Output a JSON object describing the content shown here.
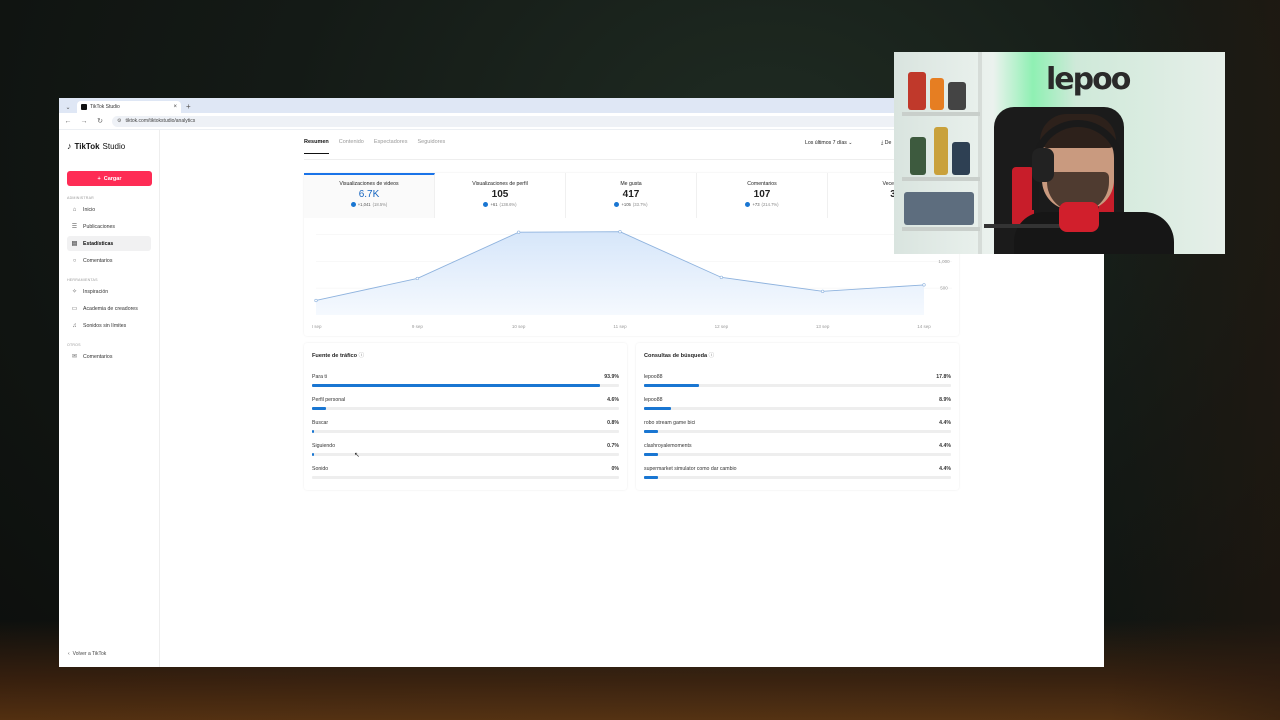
{
  "browser": {
    "tab_title": "TikTok Studio",
    "url": "tiktok.com/tiktokstudio/analytics"
  },
  "sidebar": {
    "logo_text": "TikTok",
    "logo_sub": "Studio",
    "upload_label": "Cargar",
    "section_admin": "ADMINISTRAR",
    "section_tools": "HERRAMIENTAS",
    "section_other": "OTROS",
    "items": [
      {
        "label": "Inicio",
        "icon": "home-icon"
      },
      {
        "label": "Publicaciones",
        "icon": "posts-icon"
      },
      {
        "label": "Estadísticas",
        "icon": "analytics-icon"
      },
      {
        "label": "Comentarios",
        "icon": "comments-icon"
      },
      {
        "label": "Inspiración",
        "icon": "inspiration-icon"
      },
      {
        "label": "Academia de creadores",
        "icon": "academy-icon"
      },
      {
        "label": "Sonidos sin límites",
        "icon": "music-icon"
      },
      {
        "label": "Comentarios",
        "icon": "feedback-icon"
      }
    ],
    "back_label": "Volver a TikTok"
  },
  "tabs": [
    "Resumen",
    "Contenido",
    "Espectadores",
    "Seguidores"
  ],
  "range_label": "Los últimos 7 días",
  "download_label": "De",
  "metrics": [
    {
      "label": "Visualizaciones de videos",
      "value": "6.7K",
      "delta": "+1,041",
      "pct": "(18.5%)"
    },
    {
      "label": "Visualizaciones de perfil",
      "value": "105",
      "delta": "+61",
      "pct": "(138.6%)"
    },
    {
      "label": "Me gusta",
      "value": "417",
      "delta": "+105",
      "pct": "(33.7%)"
    },
    {
      "label": "Comentarios",
      "value": "107",
      "delta": "+73",
      "pct": "(214.7%)"
    },
    {
      "label": "Veces co",
      "value": "3",
      "delta": "",
      "pct": ""
    }
  ],
  "chart_data": {
    "type": "area",
    "x": [
      "8 sep",
      "9 sep",
      "10 sep",
      "11 sep",
      "12 sep",
      "13 sep",
      "14 sep"
    ],
    "values": [
      270,
      680,
      1540,
      1550,
      700,
      440,
      560
    ],
    "yticks": [
      "1,000",
      "500"
    ],
    "ylim": [
      0,
      1600
    ],
    "color": "#1976d2"
  },
  "traffic": {
    "title": "Fuente de tráfico",
    "rows": [
      {
        "label": "Para ti",
        "pct": "93.9%",
        "value": 93.9
      },
      {
        "label": "Perfil personal",
        "pct": "4.6%",
        "value": 4.6
      },
      {
        "label": "Buscar",
        "pct": "0.8%",
        "value": 0.8
      },
      {
        "label": "Siguiendo",
        "pct": "0.7%",
        "value": 0.7
      },
      {
        "label": "Sonido",
        "pct": "0%",
        "value": 0
      }
    ]
  },
  "search": {
    "title": "Consultas de búsqueda",
    "rows": [
      {
        "label": "lepoo88",
        "pct": "17.8%",
        "value": 17.8
      },
      {
        "label": "lepoo88",
        "pct": "8.9%",
        "value": 8.9
      },
      {
        "label": "robo stream game bici",
        "pct": "4.4%",
        "value": 4.4
      },
      {
        "label": "clashroyalemoments",
        "pct": "4.4%",
        "value": 4.4
      },
      {
        "label": "supermarket simulator como dar cambio",
        "pct": "4.4%",
        "value": 4.4
      }
    ]
  },
  "webcam": {
    "wall_logo": "lepoo"
  }
}
